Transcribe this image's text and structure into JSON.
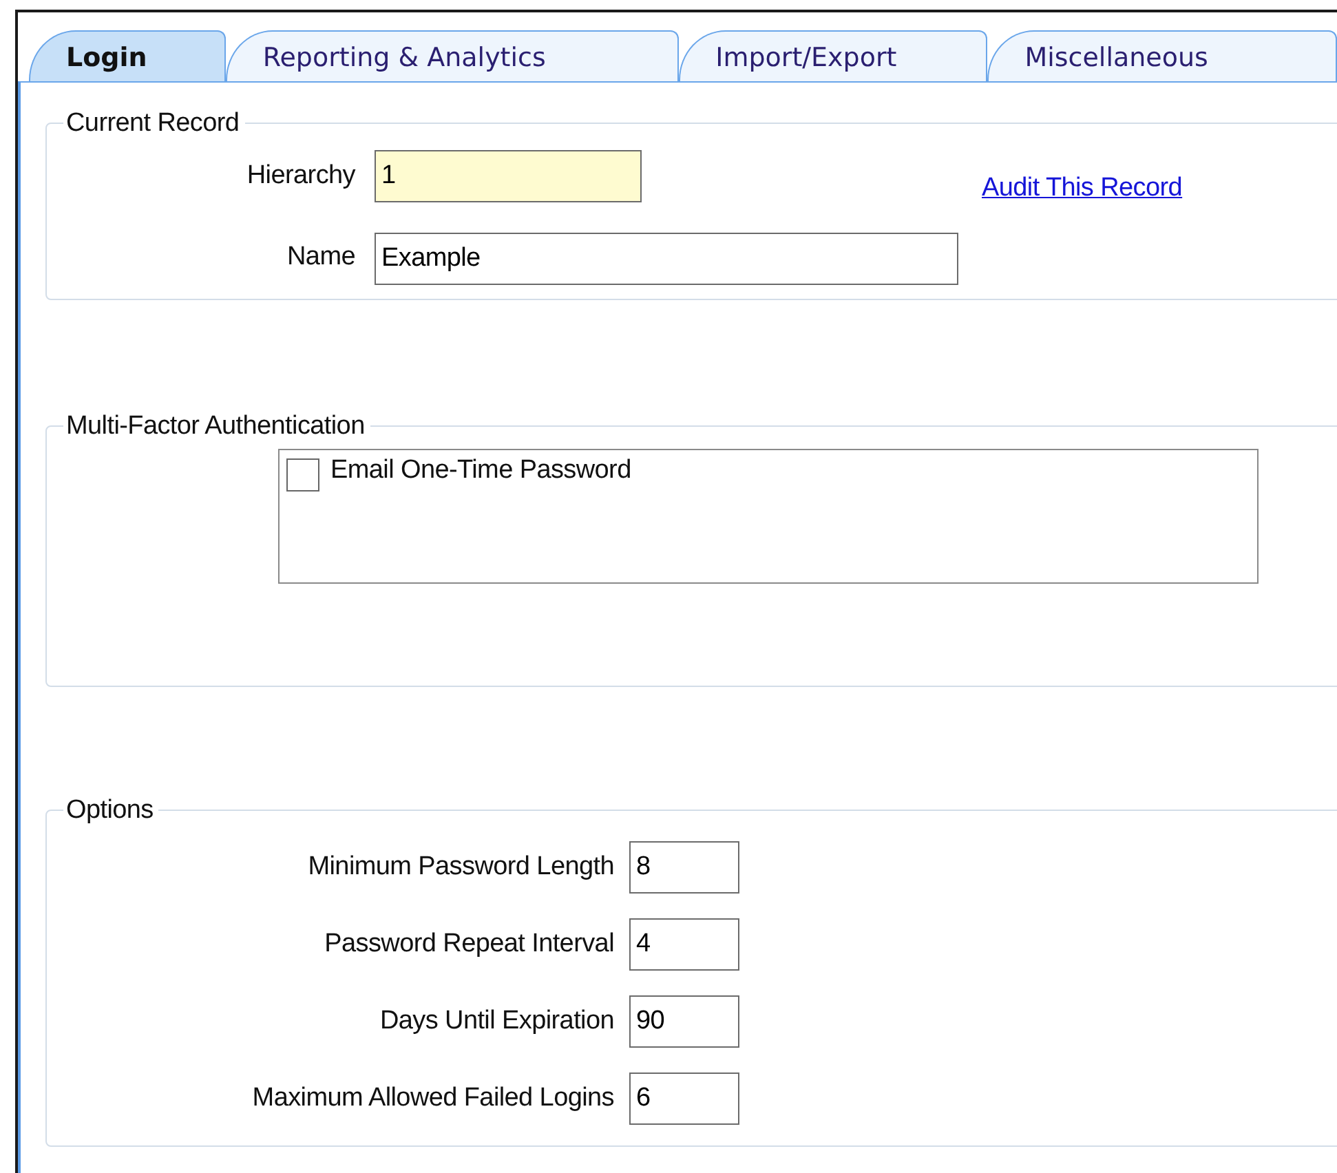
{
  "tabs": [
    {
      "label": "Login",
      "selected": true
    },
    {
      "label": "Reporting & Analytics",
      "selected": false
    },
    {
      "label": "Import/Export",
      "selected": false
    },
    {
      "label": "Miscellaneous",
      "selected": false
    }
  ],
  "current_record": {
    "title": "Current Record",
    "fields": [
      {
        "label": "Hierarchy",
        "value": "1",
        "required": true
      },
      {
        "label": "Name",
        "value": "Example",
        "required": false
      }
    ],
    "audit_link": "Audit This Record"
  },
  "multi_factor_authentication": {
    "title": "Multi-Factor Authentication",
    "options": [
      {
        "label": "Email One-Time Password",
        "checked": false
      }
    ]
  },
  "options": {
    "title": "Options",
    "fields": [
      {
        "label": "Minimum Password Length",
        "value": "8"
      },
      {
        "label": "Password Repeat Interval",
        "value": "4"
      },
      {
        "label": "Days Until Expiration",
        "value": "90"
      },
      {
        "label": "Maximum Allowed Failed Logins",
        "value": "6"
      }
    ]
  }
}
